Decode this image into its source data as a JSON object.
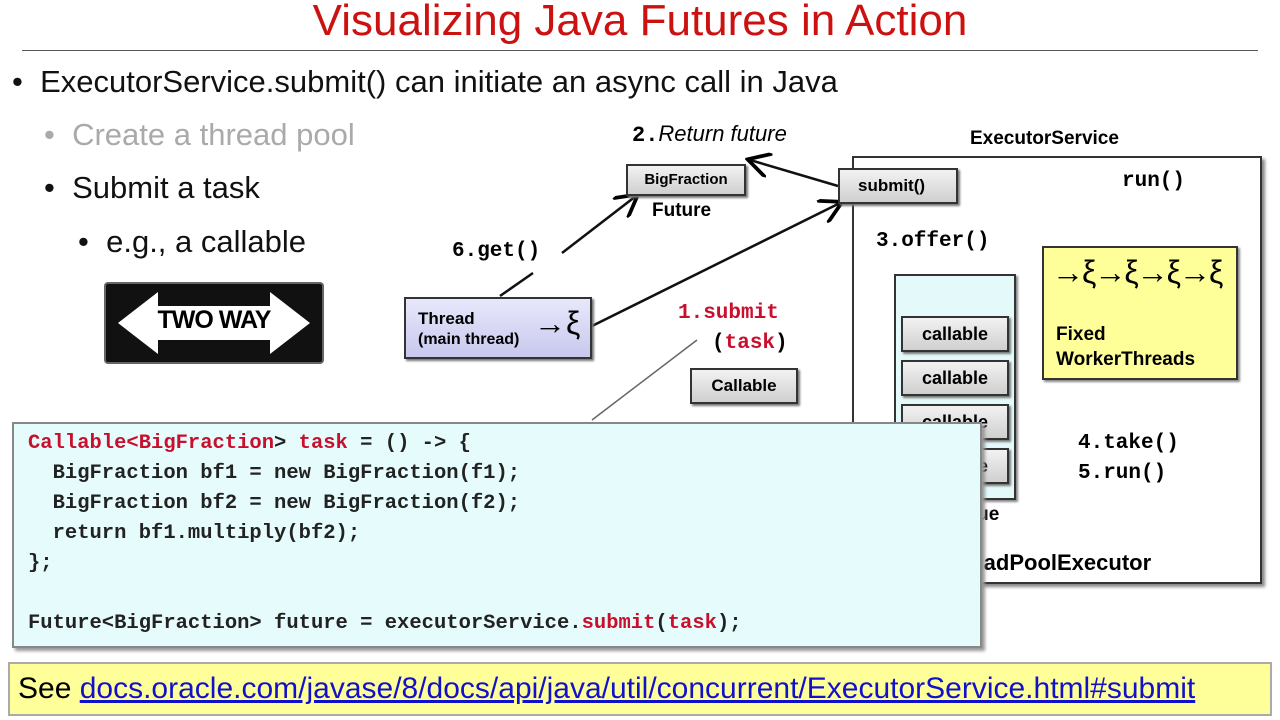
{
  "title": "Visualizing Java Futures in Action",
  "bullets": [
    {
      "text": "ExecutorService.submit() can initiate an async call in Java",
      "level": 1
    },
    {
      "text": "Create a thread pool",
      "level": 2,
      "dimmed": true
    },
    {
      "text": "Submit a task",
      "level": 2
    },
    {
      "text": "e.g., a callable",
      "level": 3
    }
  ],
  "sign": {
    "text": "TWO WAY",
    "icon": "two-way-arrow-sign"
  },
  "diagram": {
    "return_future_num": "2.",
    "return_future": "Return future",
    "bigfraction": "BigFraction",
    "future": "Future",
    "get": "6.get()",
    "thread_line1": "Thread",
    "thread_line2": "(main thread)",
    "submit_step_1": "1.submit",
    "submit_step_paren_open": "(",
    "submit_step_task": "task",
    "submit_step_paren_close": ")",
    "callable": "Callable",
    "executor_service": "ExecutorService",
    "submit_method": "submit()",
    "offer": "3.offer()",
    "run": "run()",
    "queue_items": [
      "callable",
      "callable",
      "callable",
      "callable"
    ],
    "work_queue": "WorkQueue",
    "worker_line1": "Fixed",
    "worker_line2": "WorkerThreads",
    "take": "4.take()",
    "run_step": "5.run()",
    "pool_executor": "ThreadPoolExecutor"
  },
  "code": [
    [
      {
        "t": "Callable<",
        "r": true
      },
      {
        "t": "BigFraction",
        "r": true
      },
      {
        "t": "> ",
        "r": false
      },
      {
        "t": "task",
        "r": true
      },
      {
        "t": " = () -> {",
        "r": false
      }
    ],
    [
      {
        "t": "  BigFraction bf1 = new BigFraction(f1);",
        "r": false
      }
    ],
    [
      {
        "t": "  BigFraction bf2 = new BigFraction(f2);",
        "r": false
      }
    ],
    [
      {
        "t": "  return bf1.multiply(bf2);",
        "r": false
      }
    ],
    [
      {
        "t": "};",
        "r": false
      }
    ],
    [],
    [
      {
        "t": "Future<BigFraction> future = executorService.",
        "r": false
      },
      {
        "t": "submit",
        "r": true
      },
      {
        "t": "(",
        "r": false
      },
      {
        "t": "task",
        "r": true
      },
      {
        "t": ");",
        "r": false
      }
    ]
  ],
  "footer": {
    "prefix": "See ",
    "link": "docs.oracle.com/javase/8/docs/api/java/util/concurrent/ExecutorService.html#submit"
  },
  "colors": {
    "title": "#cc1111",
    "code_bg": "#e6fbfb",
    "footer_bg": "#ffff99",
    "worker_bg": "#ffff99",
    "thread_bg": "#d8d8f8",
    "accent_red": "#c8102e",
    "link": "#1111cc"
  }
}
